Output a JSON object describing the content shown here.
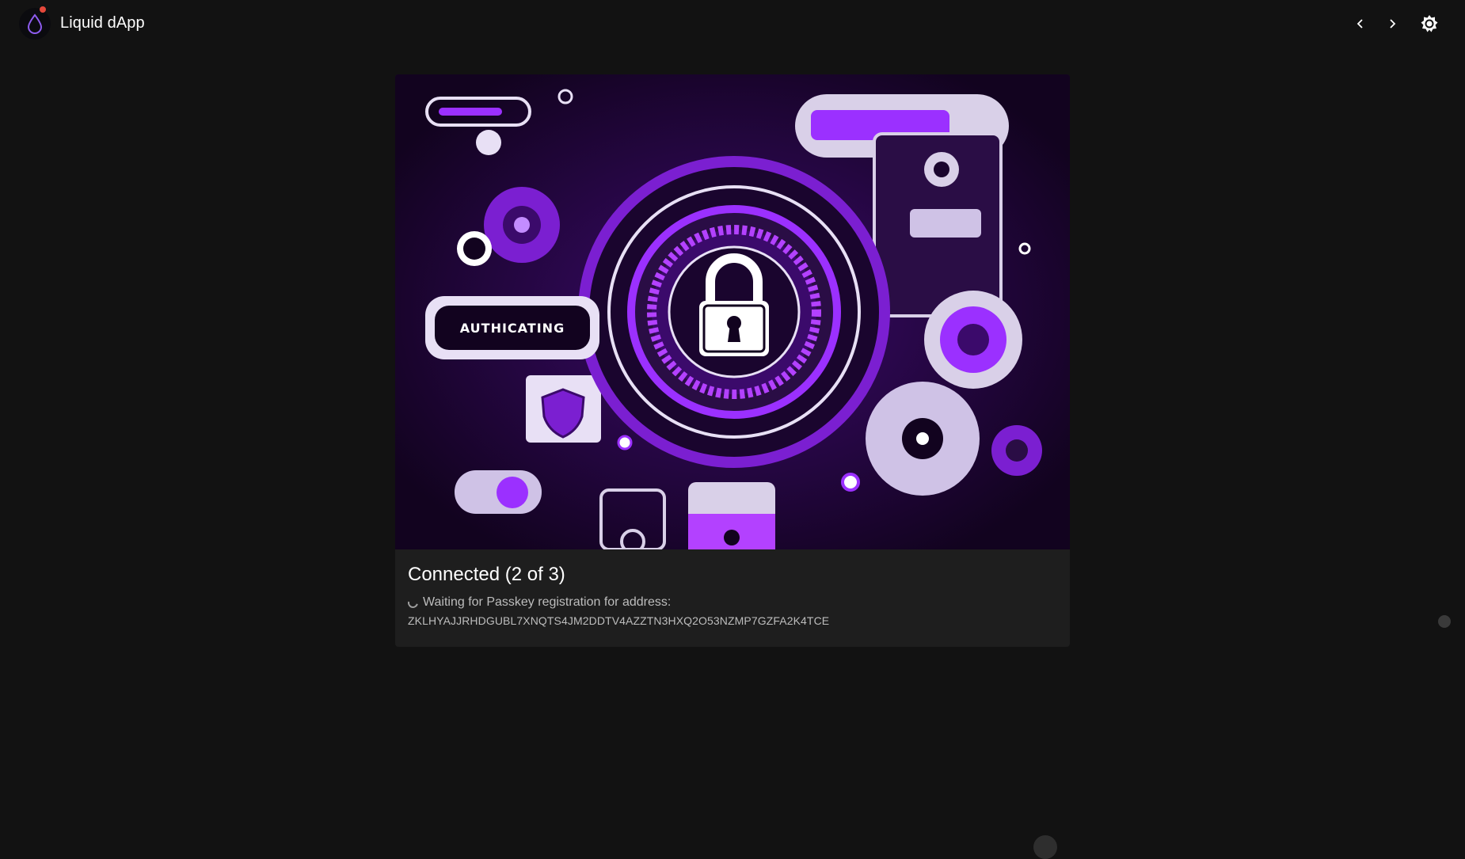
{
  "app": {
    "title": "Liquid dApp"
  },
  "colors": {
    "background": "#121212",
    "card": "#1e1e1e",
    "accent": "#8a2be2",
    "notification_dot": "#e5483b"
  },
  "icons": {
    "logo": "water-drop-icon",
    "back": "chevron-left-icon",
    "forward": "chevron-right-icon",
    "theme": "brightness-icon",
    "status": "spinner-icon"
  },
  "hero": {
    "badge_text": "AUTHICATING"
  },
  "card": {
    "title": "Connected (2 of 3)",
    "status_text": "Waiting for Passkey registration for address:",
    "address": "ZKLHYAJJRHDGUBL7XNQTS4JM2DDTV4AZZTN3HXQ2O53NZMP7GZFA2K4TCE"
  }
}
